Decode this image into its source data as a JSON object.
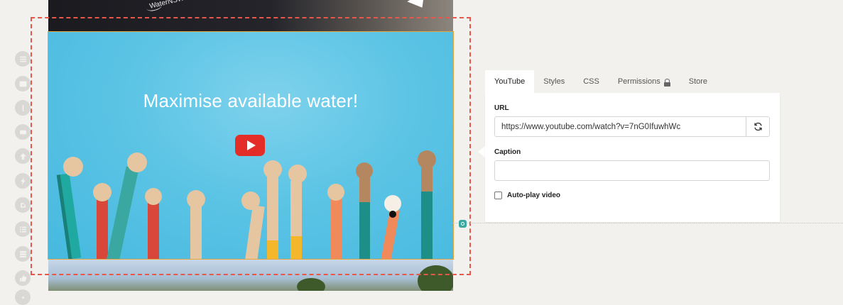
{
  "top_video": {
    "logo_text": "WaterNSW"
  },
  "video": {
    "title": "Maximise available water!",
    "play_icon": "youtube-play-icon"
  },
  "rail": {
    "icons": [
      "text-icon",
      "image-icon",
      "spacer-icon",
      "video-icon",
      "upload-icon",
      "lightning-icon",
      "embed-icon",
      "list-icon",
      "columns-icon",
      "thumbs-up-icon",
      "more-icon"
    ]
  },
  "tabs": [
    {
      "label": "YouTube",
      "active": true
    },
    {
      "label": "Styles",
      "active": false
    },
    {
      "label": "CSS",
      "active": false
    },
    {
      "label": "Permissions",
      "active": false,
      "icon": "lock-icon"
    },
    {
      "label": "Store",
      "active": false
    }
  ],
  "form": {
    "url_label": "URL",
    "url_value": "https://www.youtube.com/watch?v=7nG0IfuwhWc",
    "caption_label": "Caption",
    "caption_value": "",
    "autoplay_label": "Auto-play video",
    "autoplay_checked": false
  },
  "colors": {
    "selection_border": "#e8584a",
    "video_border": "#e8a33a",
    "youtube_red": "#e52d27",
    "video_sky": "#5cc4e5",
    "anchor_badge": "#3aa8a0"
  }
}
